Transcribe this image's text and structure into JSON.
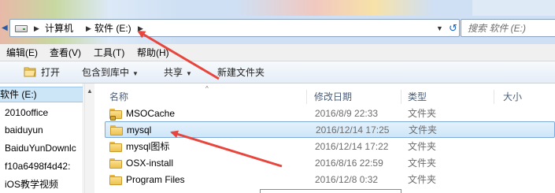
{
  "address": {
    "crumbs": [
      "计算机",
      "软件 (E:)"
    ],
    "separator": "▶",
    "dropdown_glyph": "▼",
    "refresh_glyph": "↺",
    "back_glyph": "◀",
    "icon": "drive-icon"
  },
  "search": {
    "placeholder": "搜索 软件 (E:)"
  },
  "menu": {
    "items": [
      "编辑(E)",
      "查看(V)",
      "工具(T)",
      "帮助(H)"
    ]
  },
  "toolbar": {
    "open_label": "打开",
    "include_label": "包含到库中",
    "share_label": "共享",
    "new_folder_label": "新建文件夹",
    "caret": "▼"
  },
  "nav": {
    "items": [
      "软件 (E:)",
      "2010office",
      "baiduyun",
      "BaiduYunDownlc",
      "f10a6498f4d42:",
      "iOS教学视频"
    ],
    "selected_index": 0,
    "scroll_up_glyph": "▲"
  },
  "filelist": {
    "columns": [
      "名称",
      "修改日期",
      "类型",
      "大小"
    ],
    "sort_glyph": "^",
    "rows": [
      {
        "name": "MSOCache",
        "date": "2016/8/9 22:33",
        "type": "文件夹",
        "icon": "locked-folder-icon"
      },
      {
        "name": "mysql",
        "date": "2016/12/14 17:25",
        "type": "文件夹",
        "icon": "folder-icon",
        "selected": true
      },
      {
        "name": "mysql图标",
        "date": "2016/12/14 17:22",
        "type": "文件夹",
        "icon": "folder-icon"
      },
      {
        "name": "OSX-install",
        "date": "2016/8/16 22:59",
        "type": "文件夹",
        "icon": "folder-icon"
      },
      {
        "name": "Program Files",
        "date": "2016/12/8 0:32",
        "type": "文件夹",
        "icon": "folder-icon"
      }
    ]
  },
  "colors": {
    "annotation_arrow": "#e8453c",
    "selection": "#cde6f8",
    "titlebar": "#cfe0f4"
  }
}
